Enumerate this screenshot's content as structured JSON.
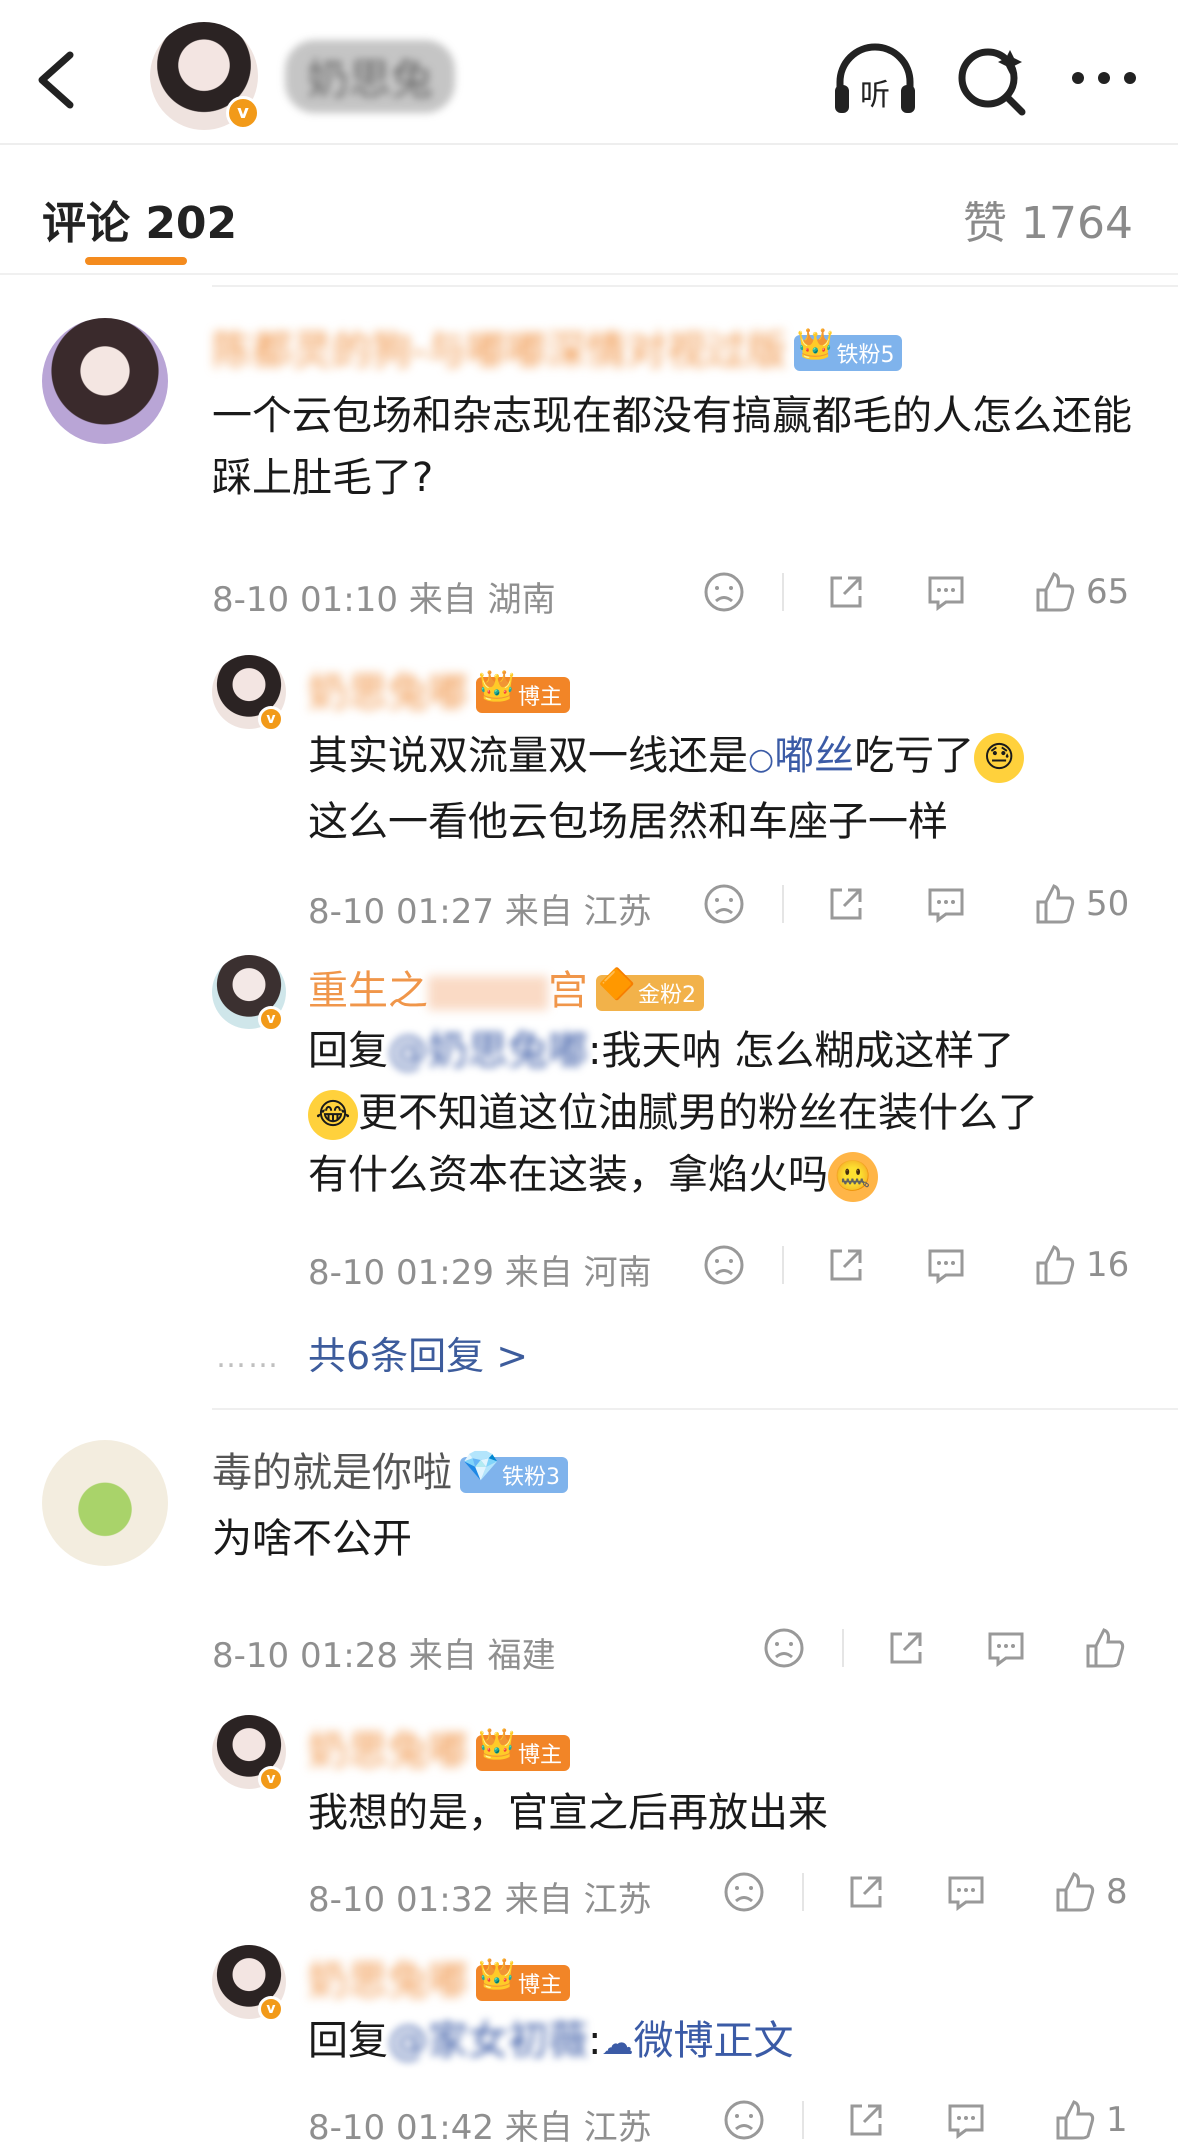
{
  "header": {
    "title": "奶思兔",
    "listen_label": "听"
  },
  "tabs": {
    "comments_label": "评论 202",
    "likes_label": "赞 1764"
  },
  "comments": [
    {
      "name": "陈都灵的狗-与嘟嘟深情对视过版",
      "badge": "铁粉5",
      "text": "一个云包场和杂志现在都没有搞赢都毛的人怎么还能踩上肚毛了?",
      "time": "8-10 01:10 来自 湖南",
      "comments_count": "",
      "likes": "65",
      "replies": [
        {
          "name": "奶思兔嘟",
          "badge": "博主",
          "text_a": "其实说双流量双一线还是",
          "mention": "嘟丝",
          "text_b": "吃亏了",
          "text_c": "这么一看他云包场居然和车座子一样",
          "time": "8-10 01:27 来自 江苏",
          "likes": "50"
        },
        {
          "name": "重生之",
          "name_tail": "宫",
          "badge": "金粉2",
          "reply_prefix": "回复",
          "reply_to": "@奶思兔嘟",
          "text_a": ":我天呐  怎么糊成这样了",
          "text_b": "更不知道这位油腻男的粉丝在装什么了",
          "text_c": "有什么资本在这装，拿焰火吗",
          "time": "8-10 01:29 来自 河南",
          "likes": "16"
        }
      ],
      "more_replies": "共6条回复 >"
    },
    {
      "name": "毒的就是你啦",
      "badge": "铁粉3",
      "text": "为啥不公开",
      "time": "8-10 01:28 来自 福建",
      "likes": "",
      "replies": [
        {
          "name": "奶思兔嘟",
          "badge": "博主",
          "text": "我想的是，官宣之后再放出来",
          "time": "8-10 01:32 来自 江苏",
          "likes": "8"
        },
        {
          "name": "奶思兔嘟",
          "badge": "博主",
          "reply_prefix": "回复",
          "reply_to": "@家女初薇",
          "text": ":",
          "link_text": "微博正文",
          "time": "8-10 01:42 来自 江苏",
          "likes": "1"
        }
      ]
    }
  ],
  "colors": {
    "accent": "#f48b1e",
    "username": "#f0964a",
    "link": "#3d5c9c",
    "meta": "#8f8f8f"
  },
  "icons": [
    "back-icon",
    "headphones-icon",
    "search-icon",
    "more-icon",
    "dislike-icon",
    "share-icon",
    "comment-icon",
    "like-icon"
  ]
}
